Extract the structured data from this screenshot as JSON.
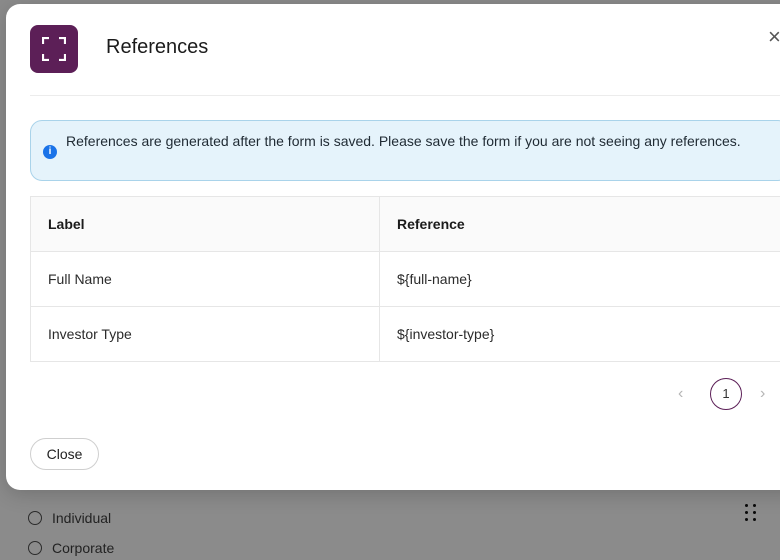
{
  "background": {
    "options": [
      "Individual",
      "Corporate"
    ]
  },
  "modal": {
    "title": "References",
    "close_icon": "×",
    "alert": {
      "icon": "i",
      "text": "References are generated after the form is saved. Please save the form if you are not seeing any references."
    },
    "table": {
      "headers": [
        "Label",
        "Reference"
      ],
      "rows": [
        [
          "Full Name",
          "${full-name}"
        ],
        [
          "Investor Type",
          "${investor-type}"
        ]
      ]
    },
    "pagination": {
      "prev": "‹",
      "current_page": "1",
      "next": "›"
    },
    "close_button": "Close"
  },
  "colors": {
    "brand": "#5c1f57",
    "alert_bg": "#e5f3fb",
    "alert_border": "#a9d3ea",
    "info_icon": "#1a73e8"
  }
}
